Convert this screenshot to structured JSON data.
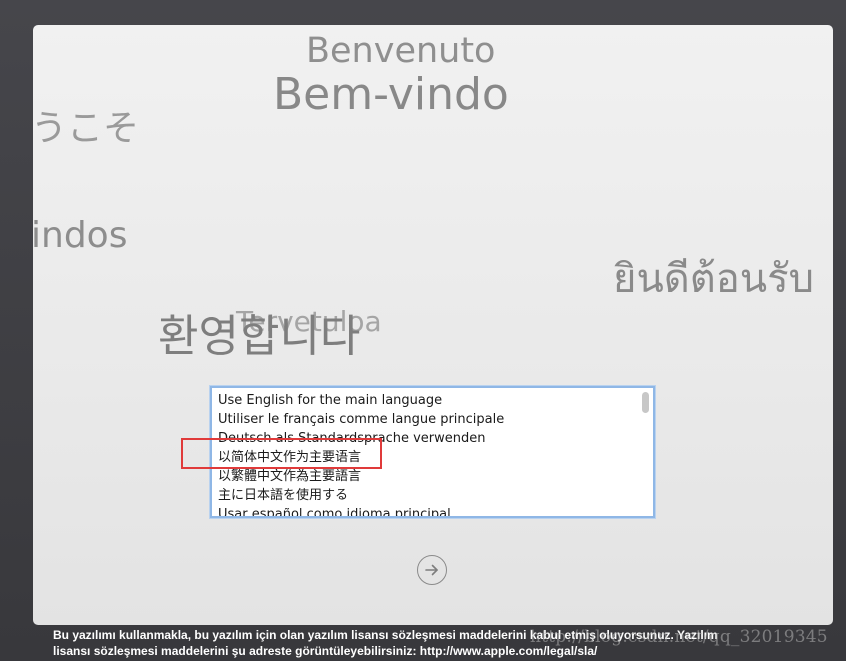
{
  "welcome_words": {
    "italian": "Benvenuto",
    "portuguese": "Bem-vindo",
    "japanese": "うこそ",
    "spanish": "indos",
    "thai": "ยินดีต้อนรับ",
    "indonesian": "Tervetuloa",
    "korean": "환영합니다"
  },
  "language_list": {
    "items": [
      "Use English for the main language",
      "Utiliser le français comme langue principale",
      "Deutsch als Standardsprache verwenden",
      "以简体中文作为主要语言",
      "以繁體中文作為主要語言",
      "主に日本語を使用する",
      "Usar español como idioma principal"
    ]
  },
  "next_button": {
    "icon": "arrow-right-circle-icon"
  },
  "highlight": {
    "color": "#e03a3a"
  },
  "footer": {
    "line1": "Bu yazılımı kullanmakla, bu yazılım için olan yazılım lisansı sözleşmesi maddelerini kabul etmiş oluyorsunuz. Yazılım",
    "line2": "lisansı sözleşmesi maddelerini şu adreste görüntüleyebilirsiniz: http://www.apple.com/legal/sla/"
  },
  "watermark": "http://blog.csdn.net/qq_32019345"
}
